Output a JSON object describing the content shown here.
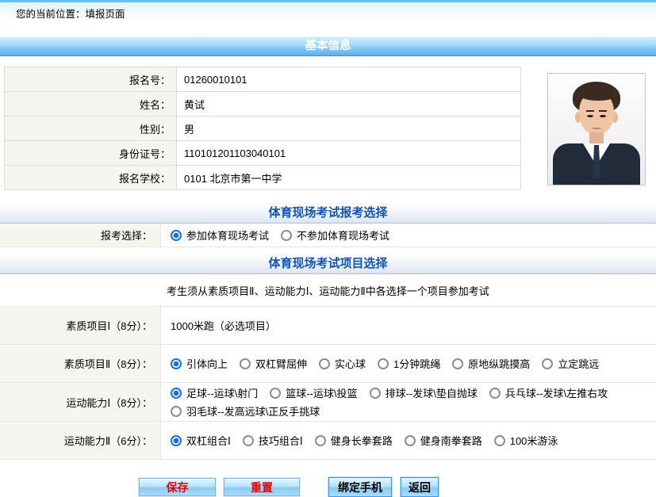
{
  "page": {
    "breadcrumb": "您的当前位置：填报页面"
  },
  "colors": {
    "top_strip_blue": "#62c2f3",
    "header_blue_top": "#cdeefd",
    "header_blue_bottom": "#5cadee",
    "section_title_blue": "#1254b4",
    "label_cell_bg": "#f6f5f0",
    "selected_radio_blue": "#156fe8",
    "save_reset_text_red": "#e60000",
    "button_face_blue": "#a9dbf8"
  },
  "basic_info": {
    "title": "基本信息",
    "photo": "id-photo-of-applicant",
    "fields": [
      {
        "label": "报名号：",
        "value": "01260010101"
      },
      {
        "label": "姓名：",
        "value": "黄试"
      },
      {
        "label": "性别：",
        "value": "男"
      },
      {
        "label": "身份证号：",
        "value": "110101201103040101"
      },
      {
        "label": "报名学校：",
        "value": "0101 北京市第一中学"
      }
    ]
  },
  "exam_choice": {
    "title": "体育现场考试报考选择",
    "row_label": "报考选择：",
    "options": [
      {
        "label": "参加体育现场考试",
        "selected": true
      },
      {
        "label": "不参加体育现场考试",
        "selected": false
      }
    ]
  },
  "item_choice": {
    "title": "体育现场考试项目选择",
    "note": "考生须从素质项目Ⅱ、运动能力Ⅰ、运动能力Ⅱ中各选择一个项目参加考试",
    "rows": [
      {
        "label": "素质项目Ⅰ（8分）：",
        "type": "text",
        "value": "1000米跑（必选项目）"
      },
      {
        "label": "素质项目Ⅱ（8分）：",
        "type": "radio",
        "options": [
          {
            "label": "引体向上",
            "selected": true
          },
          {
            "label": "双杠臂屈伸",
            "selected": false
          },
          {
            "label": "实心球",
            "selected": false
          },
          {
            "label": "1分钟跳绳",
            "selected": false
          },
          {
            "label": "原地纵跳摸高",
            "selected": false
          },
          {
            "label": "立定跳远",
            "selected": false
          }
        ]
      },
      {
        "label": "运动能力Ⅰ（8分）：",
        "type": "radio",
        "options": [
          {
            "label": "足球--运球\\射门",
            "selected": true
          },
          {
            "label": "篮球--运球\\投篮",
            "selected": false
          },
          {
            "label": "排球--发球\\垫自抛球",
            "selected": false
          },
          {
            "label": "兵乓球--发球\\左推右攻",
            "selected": false
          },
          {
            "label": "羽毛球--发高远球\\正反手挑球",
            "selected": false
          }
        ]
      },
      {
        "label": "运动能力Ⅱ（6分）：",
        "type": "radio",
        "options": [
          {
            "label": "双杠组合Ⅰ",
            "selected": true
          },
          {
            "label": "技巧组合Ⅰ",
            "selected": false
          },
          {
            "label": "健身长拳套路",
            "selected": false
          },
          {
            "label": "健身南拳套路",
            "selected": false
          },
          {
            "label": "100米游泳",
            "selected": false
          }
        ]
      }
    ]
  },
  "buttons": [
    {
      "label": "保存",
      "name": "save-button",
      "text_color": "red"
    },
    {
      "label": "重置",
      "name": "reset-button",
      "text_color": "red"
    },
    {
      "label": "绑定手机",
      "name": "bind-phone-button",
      "text_color": "black"
    },
    {
      "label": "返回",
      "name": "back-button",
      "text_color": "black"
    }
  ]
}
